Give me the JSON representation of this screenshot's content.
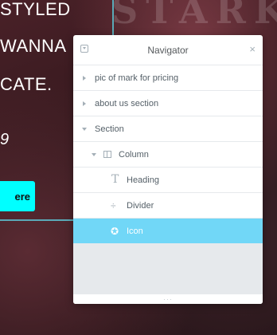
{
  "background": {
    "brand_text": "STARK",
    "line1": "STYLED",
    "line2": "WANNA",
    "line3": "CATE.",
    "number": "9",
    "cta_label": "ere"
  },
  "navigator": {
    "title": "Navigator",
    "close_symbol": "×",
    "items": [
      {
        "label": "pic of mark for pricing",
        "expanded": false,
        "icon": "caret-right-icon"
      },
      {
        "label": "about us section",
        "expanded": false,
        "icon": "caret-right-icon"
      },
      {
        "label": "Section",
        "expanded": true,
        "icon": "caret-down-icon"
      },
      {
        "label": "Column",
        "expanded": true,
        "icon": "column-icon"
      },
      {
        "label": "Heading",
        "icon": "heading-icon"
      },
      {
        "label": "Divider",
        "icon": "divider-icon"
      },
      {
        "label": "Icon",
        "icon": "star-circle-icon",
        "selected": true
      }
    ],
    "footer_handle": "···"
  },
  "colors": {
    "accent_cyan": "#00ffff",
    "selected_row": "#71d7f7",
    "guide_line": "#5aa9b7"
  }
}
